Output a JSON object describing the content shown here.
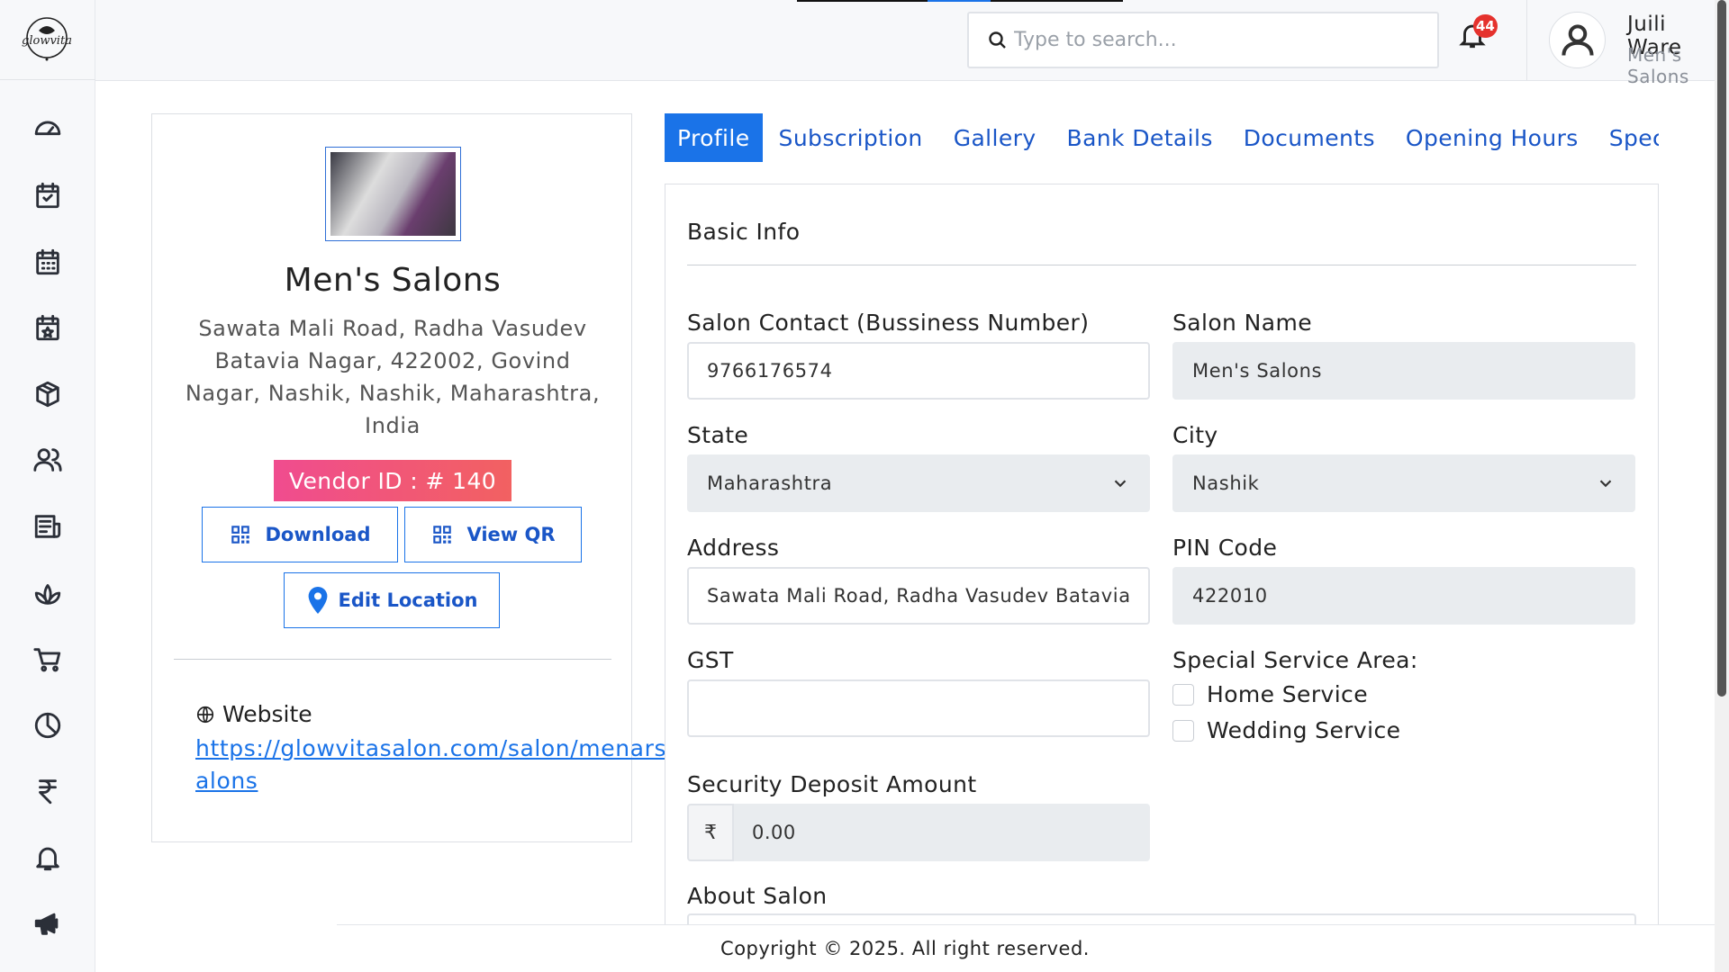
{
  "brand": {
    "logo_text": "glowvita"
  },
  "sidebar": {
    "items": [
      {
        "icon": "dashboard-icon"
      },
      {
        "icon": "calendar-check-icon"
      },
      {
        "icon": "calendar-grid-icon"
      },
      {
        "icon": "calendar-star-icon"
      },
      {
        "icon": "package-icon"
      },
      {
        "icon": "users-icon"
      },
      {
        "icon": "invoice-icon"
      },
      {
        "icon": "lotus-icon"
      },
      {
        "icon": "cart-icon"
      },
      {
        "icon": "pie-chart-icon"
      },
      {
        "icon": "rupee-icon"
      },
      {
        "icon": "bell-icon"
      },
      {
        "icon": "megaphone-icon"
      }
    ]
  },
  "header": {
    "search_placeholder": "Type to search...",
    "notification_count": "44",
    "user_name": "Juili Ware",
    "user_role": "Men's Salons"
  },
  "profile": {
    "salon_name": "Men's Salons",
    "address": "Sawata Mali Road, Radha Vasudev Batavia Nagar, 422002, Govind Nagar, Nashik, Nashik, Maharashtra, India",
    "vendor_id": "Vendor ID : # 140",
    "download_label": "Download",
    "view_qr_label": "View QR",
    "edit_location_label": "Edit Location",
    "website_label": "Website",
    "website_url": "https://glowvitasalon.com/salon/menars-salons"
  },
  "tabs": [
    {
      "label": "Profile",
      "active": true
    },
    {
      "label": "Subscription"
    },
    {
      "label": "Gallery"
    },
    {
      "label": "Bank Details"
    },
    {
      "label": "Documents"
    },
    {
      "label": "Opening Hours"
    },
    {
      "label": "Speci"
    }
  ],
  "form": {
    "section_title": "Basic Info",
    "contact_label": "Salon Contact (Bussiness Number)",
    "contact_value": "9766176574",
    "salon_name_label": "Salon Name",
    "salon_name_value": "Men's Salons",
    "state_label": "State",
    "state_value": "Maharashtra",
    "city_label": "City",
    "city_value": "Nashik",
    "address_label": "Address",
    "address_value": "Sawata Mali Road, Radha Vasudev Batavia",
    "pin_label": "PIN Code",
    "pin_value": "422010",
    "gst_label": "GST",
    "gst_value": "",
    "special_area_label": "Special Service Area:",
    "home_service_label": "Home Service",
    "wedding_service_label": "Wedding Service",
    "deposit_label": "Security Deposit Amount",
    "currency_symbol": "₹",
    "deposit_value": "0.00",
    "about_label": "About Salon"
  },
  "footer": {
    "text": "Copyright © 2025. All right reserved."
  },
  "colors": {
    "accent": "#1a73e8",
    "badge_pink": "#f04c8f",
    "notification_red": "#e5322d"
  }
}
